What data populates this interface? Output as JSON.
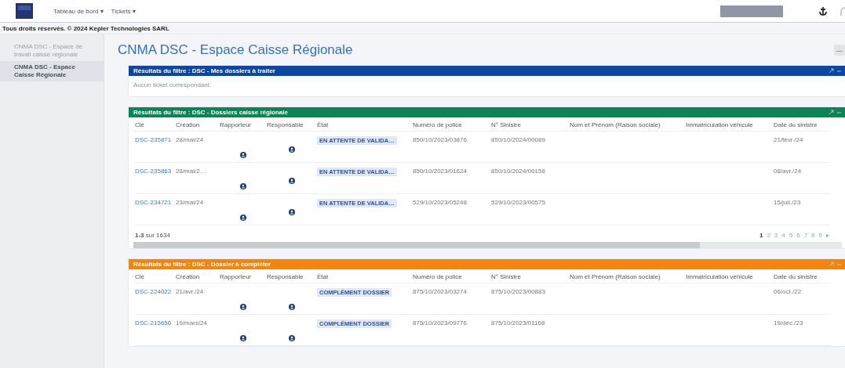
{
  "header": {
    "menus": [
      {
        "label": "Tableau de bord",
        "caret": "▾"
      },
      {
        "label": "Tickets",
        "caret": "▾"
      }
    ]
  },
  "copyright": "Tous droits réservés. © 2024 Kepler Technologies SARL",
  "sidebar": {
    "items": [
      {
        "label": "CNMA DSC - Espace de travail caisse régionale",
        "selected": false
      },
      {
        "label": "CNMA DSC - Espace Caisse Régionale",
        "selected": true
      }
    ]
  },
  "page_title": "CNMA DSC - Espace Caisse Régionale",
  "collapse_button": "—",
  "panels": [
    {
      "title": "Résultats du filtre : DSC - Mes dossiers à traiter",
      "color": "#0d47a1",
      "empty_text": "Aucun ticket correspondant."
    },
    {
      "title": "Résultats du filtre : DSC - Dossiers caisse régionale",
      "color": "#0b8457",
      "columns": [
        "Clé",
        "Création",
        "Rapporteur",
        "Responsable",
        "État",
        "Numéro de police",
        "N° Sinistre",
        "Nom et Prénom (Raison sociale)",
        "Immatriculation véhicule",
        "Date du sinistre"
      ],
      "rows": [
        {
          "key": "DSC-235871",
          "created": "28/mai/24",
          "status": "EN ATTENTE DE VALIDA…",
          "policy": "850/10/2023/03876",
          "claim": "850/10/2024/00089",
          "date": "21/févr./24"
        },
        {
          "key": "DSC-235863",
          "created": "28/mai/2…",
          "status": "EN ATTENTE DE VALIDA…",
          "policy": "850/10/2023/01624",
          "claim": "850/10/2024/00158",
          "date": "08/avr./24"
        },
        {
          "key": "DSC-234721",
          "created": "23/mai/24",
          "status": "EN ATTENTE DE VALIDA…",
          "policy": "529/10/2023/05248",
          "claim": "529/10/2023/00575",
          "date": "15/juil./23"
        }
      ],
      "range": "**1-3** sur 1634",
      "pages": [
        {
          "label": "1",
          "selected": true
        },
        {
          "label": "2",
          "selected": false
        },
        {
          "label": "3",
          "selected": false
        },
        {
          "label": "4",
          "selected": false
        },
        {
          "label": "5",
          "selected": false
        },
        {
          "label": "6",
          "selected": false
        },
        {
          "label": "7",
          "selected": false
        },
        {
          "label": "8",
          "selected": false
        },
        {
          "label": "9",
          "selected": false
        },
        {
          "label": "▸",
          "selected": false
        }
      ]
    },
    {
      "title": "Résultats du filtre : DSC - Dossier à compléter",
      "color": "#f5850a",
      "columns": [
        "Clé",
        "Création",
        "Rapporteur",
        "Responsable",
        "État",
        "Numéro de police",
        "N° Sinistre",
        "Nom et Prénom (Raison sociale)",
        "Immatriculation véhicule",
        "Date du sinistre"
      ],
      "rows": [
        {
          "key": "DSC-224022",
          "created": "21/avr./24",
          "status": "COMPLÉMENT DOSSIER",
          "policy": "875/10/2023/03274",
          "claim": "875/10/2023/00883",
          "date": "06/oct./22"
        },
        {
          "key": "DSC-215656",
          "created": "19/mars/24",
          "status": "COMPLÉMENT DOSSIER",
          "policy": "875/10/2023/09776",
          "claim": "875/10/2023/01168",
          "date": "19/déc./23"
        }
      ]
    }
  ]
}
